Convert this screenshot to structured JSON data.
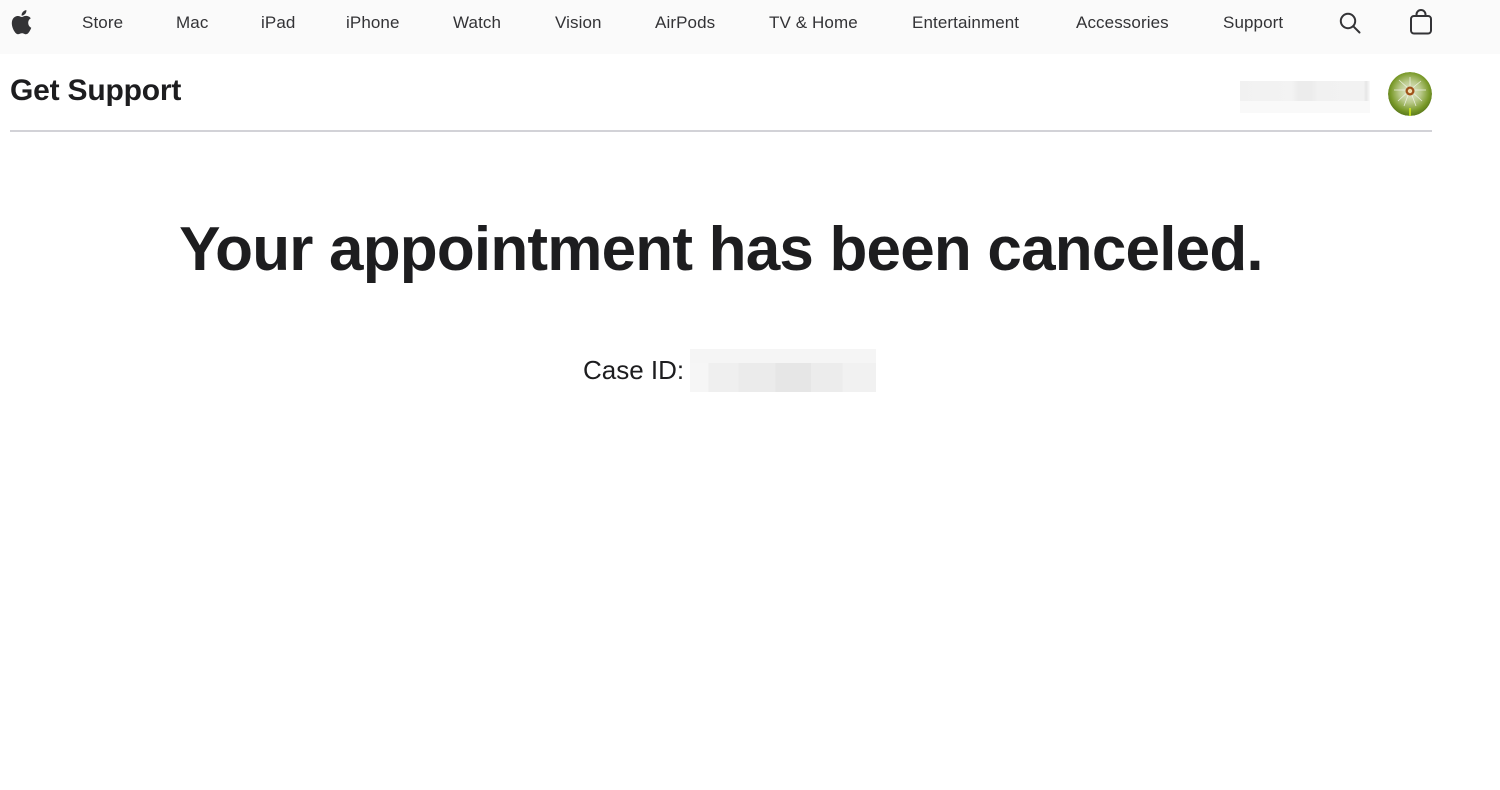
{
  "globalnav": {
    "logo": "apple-logo",
    "items": [
      {
        "label": "Store"
      },
      {
        "label": "Mac"
      },
      {
        "label": "iPad"
      },
      {
        "label": "iPhone"
      },
      {
        "label": "Watch"
      },
      {
        "label": "Vision"
      },
      {
        "label": "AirPods"
      },
      {
        "label": "TV & Home"
      },
      {
        "label": "Entertainment"
      },
      {
        "label": "Accessories"
      },
      {
        "label": "Support"
      }
    ],
    "search_icon": "search-icon",
    "bag_icon": "shopping-bag-icon"
  },
  "subnav": {
    "title": "Get Support",
    "account_name": "",
    "avatar": "avatar-dandelion"
  },
  "main": {
    "headline": "Your appointment has been canceled.",
    "case_label": "Case ID:",
    "case_value": ""
  }
}
